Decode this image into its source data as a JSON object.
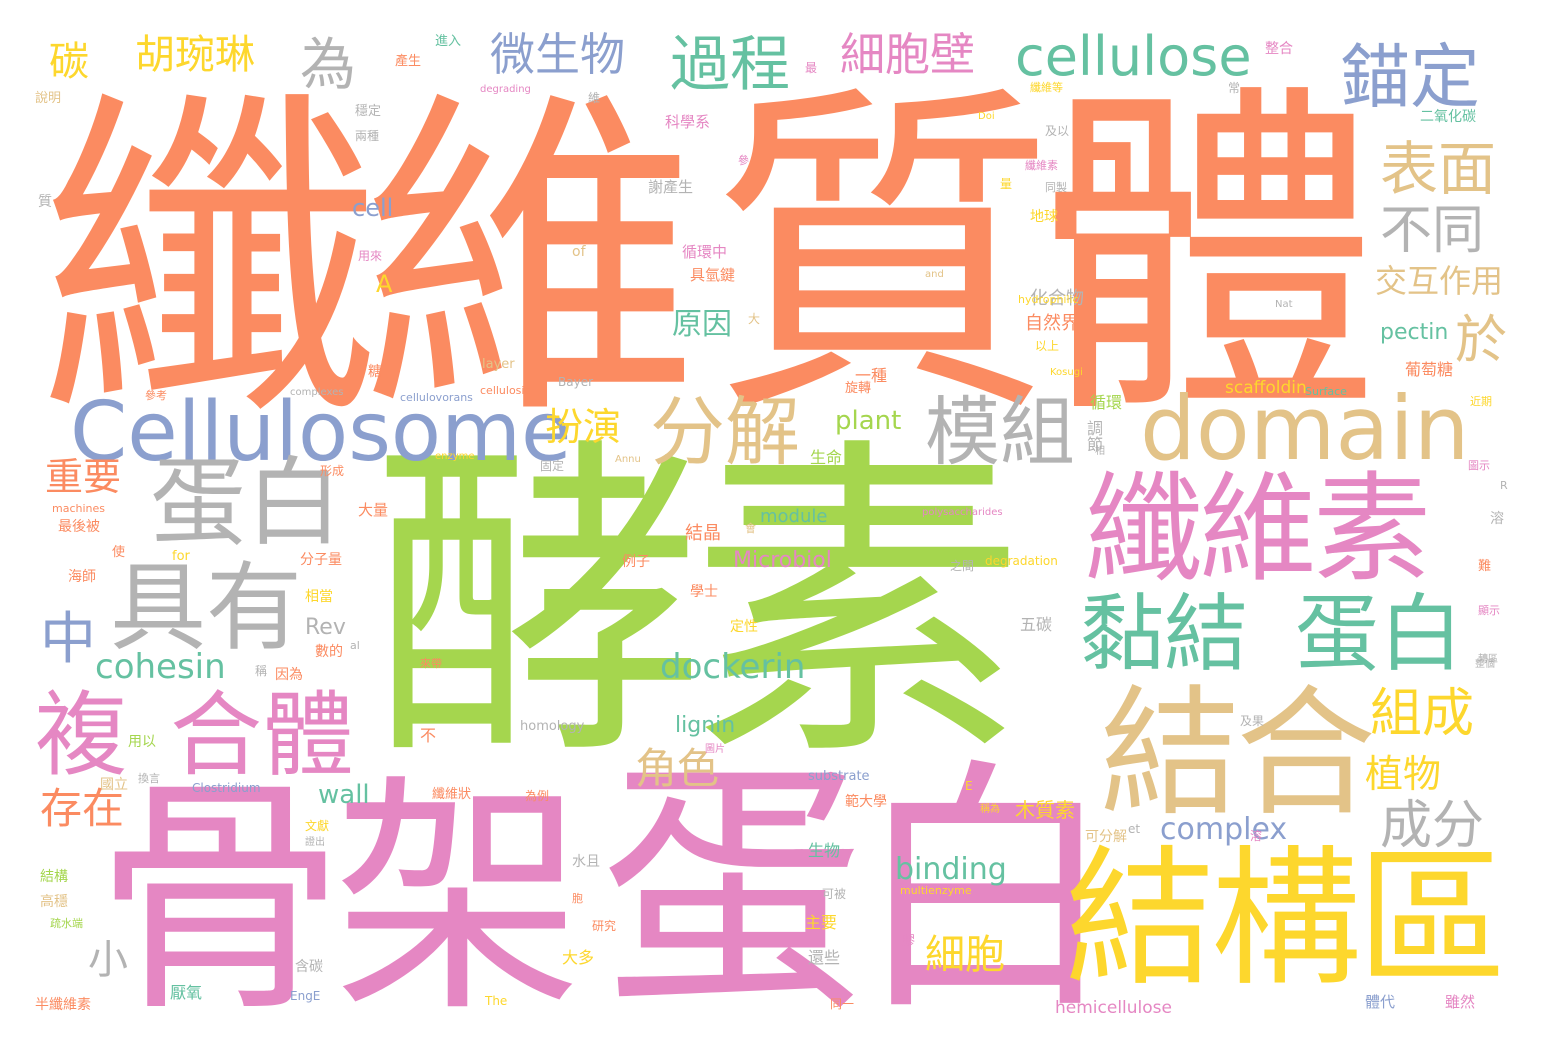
{
  "palette": {
    "orange": "#fb8b61",
    "green": "#a5d64e",
    "pink": "#e587c3",
    "yellow": "#fdd72d",
    "tan": "#e3c388",
    "blue": "#8b9fce",
    "teal": "#65c1a1",
    "gray": "#b3b3b3"
  },
  "words": {
    "w001": "纖維",
    "w002": "質體",
    "w003": "酵素",
    "w004": "骨架",
    "w005": "蛋白",
    "w006": "結構區",
    "w007": "Cellulosome",
    "w008": "domain",
    "w009": "纖維素",
    "w010": "結合",
    "w011": "蛋白",
    "w012": "具有",
    "w013": "黏結",
    "w014": "蛋白",
    "w015": "複",
    "w016": "合體",
    "w017": "分解",
    "w018": "模組",
    "w019": "cellulose",
    "w020": "錨定",
    "w021": "過程",
    "w022": "細胞壁",
    "w023": "微生物",
    "w024": "胡琬琳",
    "w025": "碳",
    "w026": "為",
    "w027": "表面",
    "w028": "不同",
    "w029": "交互作用",
    "w030": "於",
    "w031": "組成",
    "w032": "成分",
    "w033": "存在",
    "w034": "cohesin",
    "w035": "dockerin",
    "w036": "中",
    "w037": "重要",
    "w038": "扮演",
    "w039": "角色",
    "w040": "植物",
    "w041": "細胞",
    "w042": "binding",
    "w043": "complex",
    "w044": "wall",
    "w045": "plant",
    "w046": "pectin",
    "w047": "scaffoldin",
    "w048": "Microbiol",
    "w049": "module",
    "w050": "Rev",
    "w051": "lignin",
    "w052": "原因",
    "w053": "小",
    "w054": "cell",
    "w055": "A",
    "w056": "化合物",
    "w057": "自然界",
    "w058": "葡萄糖",
    "w059": "循環",
    "w060": "調節",
    "w061": "生命",
    "w062": "結晶",
    "w063": "學士",
    "w064": "定性",
    "w065": "五碳",
    "w066": "木質素",
    "w067": "可分解",
    "w068": "生物",
    "w069": "主要",
    "w070": "還些",
    "w071": "大多",
    "w072": "含碳",
    "w073": "厭氧",
    "w074": "半纖維素",
    "w075": "高穩",
    "w076": "結構",
    "w077": "用以",
    "w078": "國立",
    "w079": "hemicellulose",
    "w080": "homology",
    "w081": "substrate",
    "w082": "Clostridium",
    "w083": "multienzyme",
    "w084": "degradation",
    "w085": "polysaccharides",
    "w086": "cellulovorans",
    "w087": "cellulosic",
    "w088": "Surface",
    "w089": "hydrophilic",
    "w090": "Kosugi",
    "w091": "Bayer",
    "w092": "layer",
    "w093": "complexes",
    "w094": "enzyme",
    "w095": "machines",
    "w096": "for",
    "w097": "of",
    "w098": "and",
    "w099": "Nat",
    "w100": "Doi",
    "w101": "The",
    "w102": "EngE",
    "w103": "et",
    "w104": "al",
    "w105": "Annu",
    "w106": "R",
    "w107": "E",
    "w108": "degrading",
    "w109": "說明",
    "w110": "產生",
    "w111": "進入",
    "w112": "穩定",
    "w113": "兩種",
    "w114": "科學系",
    "w115": "謝產生",
    "w116": "循環中",
    "w117": "具氫鍵",
    "w118": "一種",
    "w119": "旋轉",
    "w120": "二氧化碳",
    "w121": "整合",
    "w122": "地球",
    "w123": "以上",
    "w124": "近期",
    "w125": "圖示",
    "w126": "大量",
    "w127": "分子量",
    "w128": "相當",
    "w129": "數的",
    "w130": "因為",
    "w131": "最後被",
    "w132": "海師",
    "w133": "使",
    "w134": "形成",
    "w135": "參考",
    "w136": "糖",
    "w137": "用來",
    "w138": "質",
    "w139": "例子",
    "w140": "固定",
    "w141": "之間",
    "w142": "雖然",
    "w143": "體代",
    "w144": "同一",
    "w145": "研究",
    "w146": "可被",
    "w147": "纖維狀",
    "w148": "為例",
    "w149": "範大學",
    "w150": "文獻",
    "w151": "水且",
    "w152": "圖片",
    "w153": "及果",
    "w154": "不",
    "w155": "來帶",
    "w156": "稱",
    "w157": "換言",
    "w158": "疏水端",
    "w159": "整個",
    "w160": "證出",
    "w161": "溶",
    "w162": "難",
    "w163": "顯示",
    "w164": "稱為",
    "w165": "纖維等",
    "w166": "常",
    "w167": "最",
    "w168": "及以",
    "w169": "纖維素",
    "w170": "量",
    "w171": "同製",
    "w172": "大",
    "w173": "參",
    "w174": "會",
    "w175": "膠",
    "w176": "胞",
    "w177": "溶",
    "w178": "相",
    "w179": "維",
    "w180": "轉區"
  }
}
